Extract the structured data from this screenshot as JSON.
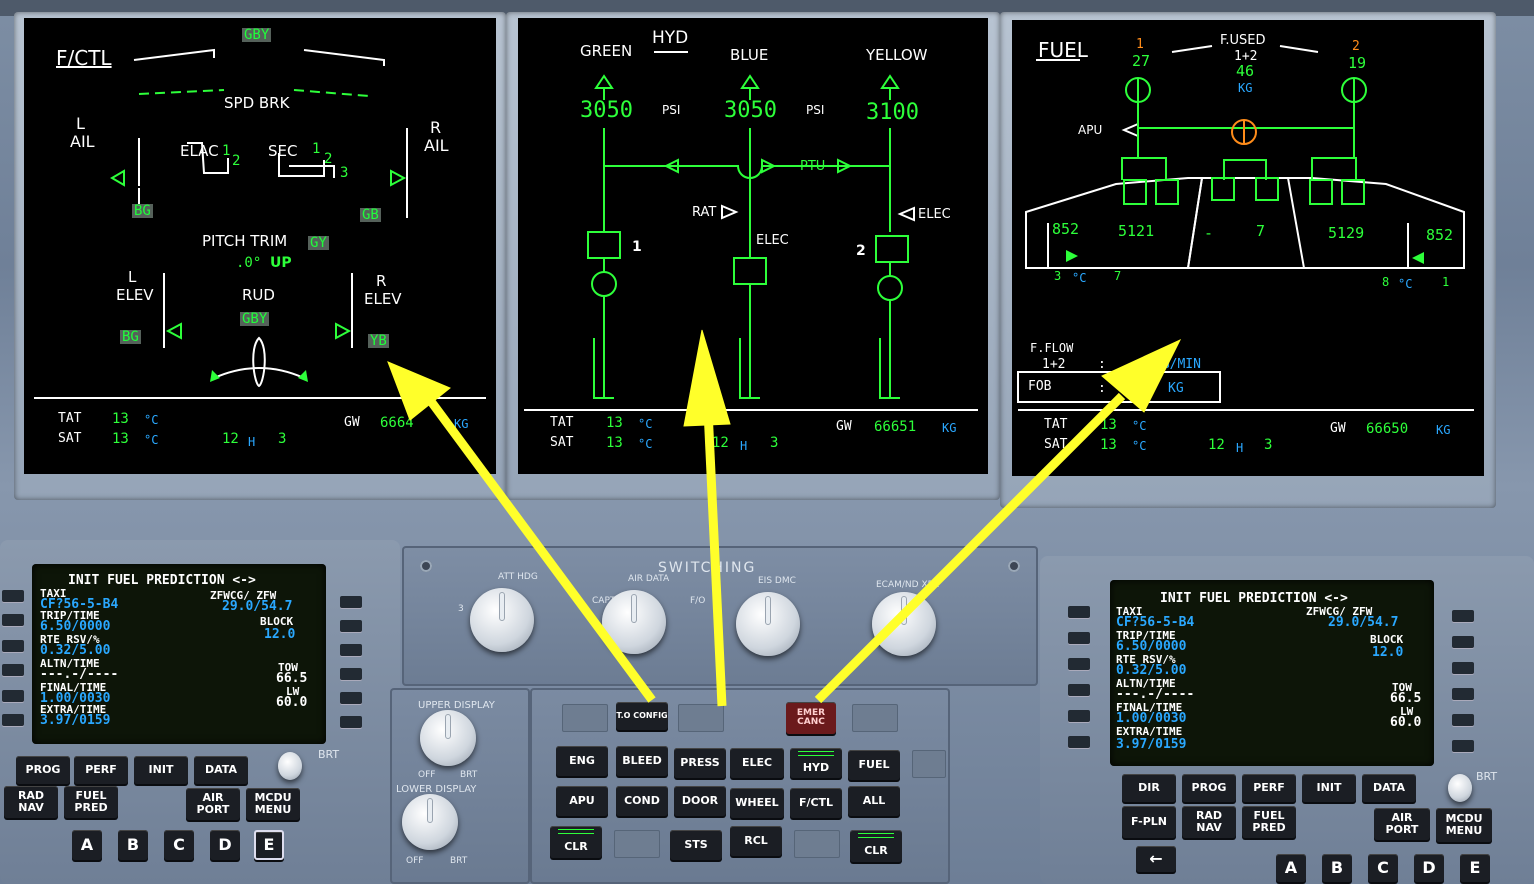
{
  "fctl": {
    "title": "F/CTL",
    "hyd_top": "GBY",
    "spd_brk": "SPD BRK",
    "l_ail_l": "L",
    "l_ail_a": "AIL",
    "r_ail_r": "R",
    "r_ail_a": "AIL",
    "elac": "ELAC",
    "elac1": "1",
    "elac2": "2",
    "sec": "SEC",
    "sec1": "1",
    "sec2": "2",
    "sec3": "3",
    "l_ail_hyd": "BG",
    "r_ail_hyd": "GB",
    "pitch_trim": "PITCH TRIM",
    "pitch_trim_hyd": "GY",
    "pitch_val": ".0°",
    "pitch_dir": "UP",
    "l_elev_l": "L",
    "l_elev_e": "ELEV",
    "r_elev_r": "R",
    "r_elev_e": "ELEV",
    "rud": "RUD",
    "rud_hyd": "GBY",
    "l_elev_hyd": "BG",
    "r_elev_hyd": "YB"
  },
  "hyd": {
    "title": "HYD",
    "green": "GREEN",
    "blue": "BLUE",
    "yellow": "YELLOW",
    "green_psi": "3050",
    "blue_psi": "3050",
    "yellow_psi": "3100",
    "psi1": "PSI",
    "psi2": "PSI",
    "ptu": "PTU",
    "rat": "RAT",
    "elec_blue": "ELEC",
    "elec_yellow": "ELEC",
    "eng1": "1",
    "eng2": "2"
  },
  "fuel": {
    "title": "FUEL",
    "eng1": "1",
    "eng2": "2",
    "fused": "F.USED",
    "fused_sub": "1+2",
    "fused1": "27",
    "fused2": "19",
    "fused_total": "46",
    "fused_unit": "KG",
    "apu": "APU",
    "left_outer": "852",
    "left_inner": "5121",
    "center_dash": "-",
    "center": "7",
    "right_inner": "5129",
    "right_outer": "852",
    "l_temp": "3",
    "l_temp_unit": "°C",
    "l_temp2": "7",
    "r_temp": "8",
    "r_temp_unit": "°C",
    "r_temp2": "1",
    "fflow": "F.FLOW",
    "fflow_sub": "1+2",
    "fflow_colon": ":",
    "fflow_unit": "KG/MIN",
    "fob": "FOB",
    "fob_colon": ":",
    "fob_val": "7",
    "fob_unit": "KG"
  },
  "sd_footer": [
    {
      "tat": "TAT",
      "tat_v": "13",
      "tat_u": "°C",
      "sat": "SAT",
      "sat_v": "13",
      "sat_u": "°C",
      "time_h": "12",
      "time_hl": "H",
      "time_m": "3",
      "gw": "GW",
      "gw_v": "6664",
      "gw_u": "KG"
    },
    {
      "tat": "TAT",
      "tat_v": "13",
      "tat_u": "°C",
      "sat": "SAT",
      "sat_v": "13",
      "sat_u": "°C",
      "time_h": "12",
      "time_hl": "H",
      "time_m": "3",
      "gw": "GW",
      "gw_v": "66651",
      "gw_u": "KG"
    },
    {
      "tat": "TAT",
      "tat_v": "13",
      "tat_u": "°C",
      "sat": "SAT",
      "sat_v": "13",
      "sat_u": "°C",
      "time_h": "12",
      "time_hl": "H",
      "time_m": "3",
      "gw": "GW",
      "gw_v": "66650",
      "gw_u": "KG"
    }
  ],
  "mcdu": {
    "title": "INIT FUEL PREDICTION <->",
    "taxi": "TAXI",
    "taxi_v": "CF?56-5-B4",
    "zfwcg": "ZFWCG/ ZFW",
    "zfwcg_v": "29.0/54.7",
    "trip": "TRIP/TIME",
    "trip_v": "6.50/0000",
    "block": "BLOCK",
    "block_v": "12.0",
    "rte": "RTE RSV/%",
    "rte_v": "0.32/5.00",
    "altn": "ALTN/TIME",
    "altn_v": "---.-/----",
    "tow": "TOW",
    "tow_v": "66.5",
    "final": "FINAL/TIME",
    "final_v": "1.00/0030",
    "lw": "LW",
    "lw_v": "60.0",
    "extra": "EXTRA/TIME",
    "extra_v": "3.97/0159",
    "brt": "BRT"
  },
  "mcdu_keys_left": [
    "PROG",
    "PERF",
    "INIT",
    "DATA",
    "RAD NAV",
    "FUEL PRED",
    "AIR PORT",
    "MCDU MENU"
  ],
  "mcdu_keys_right": [
    "DIR",
    "PROG",
    "PERF",
    "INIT",
    "DATA",
    "F-PLN",
    "RAD NAV",
    "FUEL PRED",
    "AIR PORT",
    "MCDU MENU"
  ],
  "letters": [
    "A",
    "B",
    "C",
    "D",
    "E"
  ],
  "switching": {
    "title": "SWITCHING",
    "att_hdg": "ATT HDG",
    "air_data": "AIR DATA",
    "eis_dmc": "EIS DMC",
    "ecam_nd_xfr": "ECAM/ND XFR",
    "capt": "CAPT",
    "fo": "F/O",
    "n3": "3"
  },
  "ecam": {
    "to_config": "T.O CONFIG",
    "emer_canc": "EMER CANC",
    "eng": "ENG",
    "bleed": "BLEED",
    "press": "PRESS",
    "elec": "ELEC",
    "hyd": "HYD",
    "fuel": "FUEL",
    "apu": "APU",
    "cond": "COND",
    "door": "DOOR",
    "wheel": "WHEEL",
    "fctl": "F/CTL",
    "all": "ALL",
    "clr": "CLR",
    "sts": "STS",
    "rcl": "RCL",
    "upper": "UPPER DISPLAY",
    "lower": "LOWER DISPLAY",
    "off": "OFF",
    "brt": "BRT"
  },
  "colors": {
    "green": "#2dff3a",
    "blue": "#2aa8ff",
    "amber": "#ff8c1a",
    "arrow": "#ffff2a"
  }
}
